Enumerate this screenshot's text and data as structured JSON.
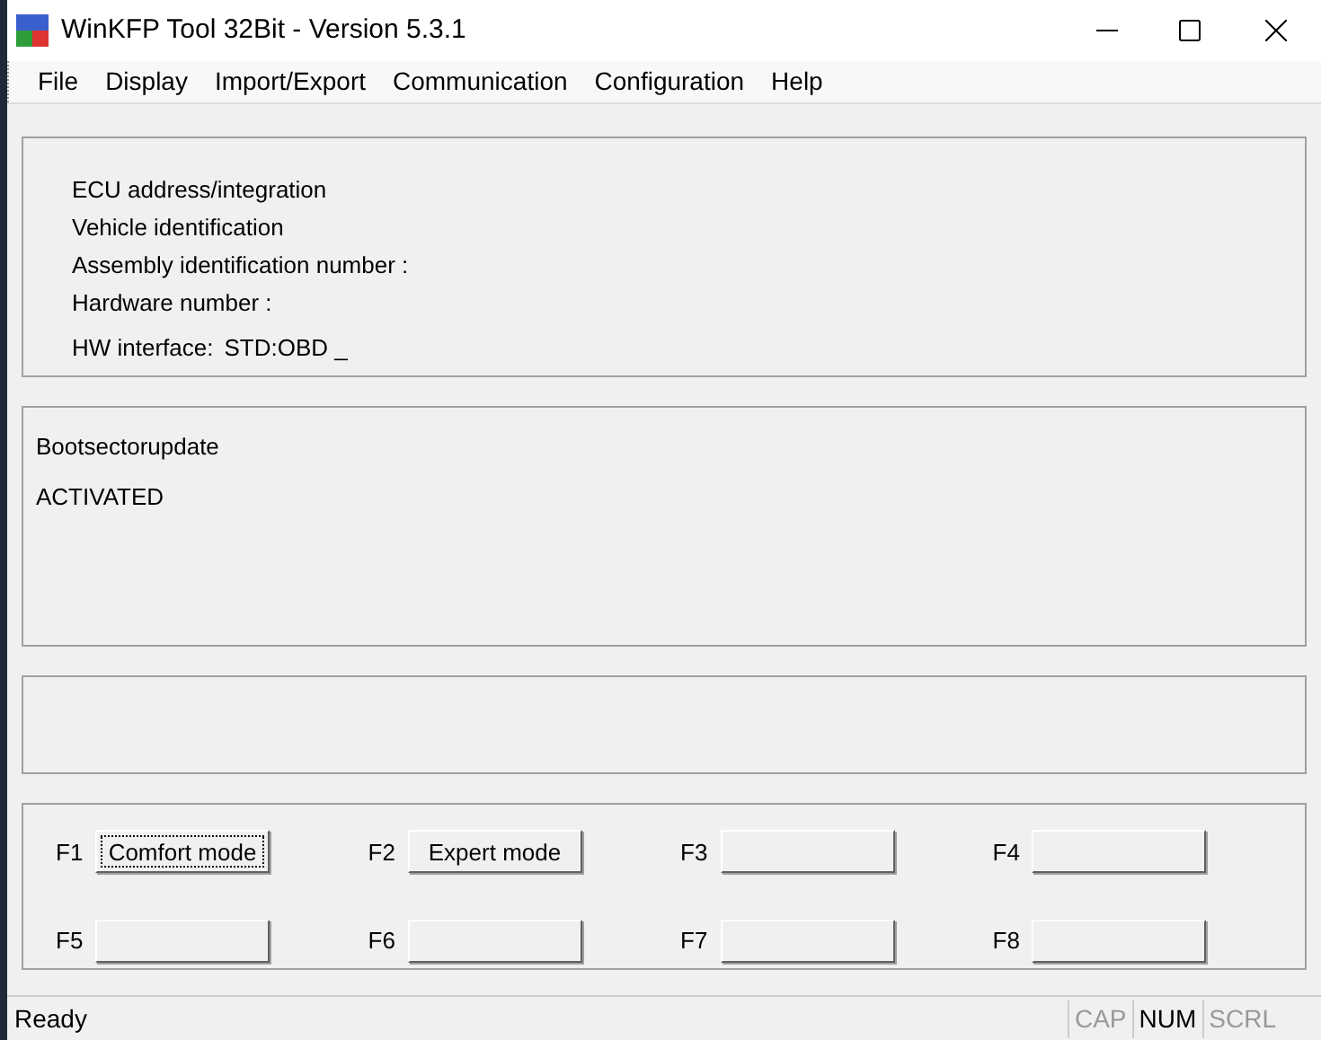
{
  "window": {
    "title": "WinKFP Tool 32Bit - Version 5.3.1"
  },
  "menu": [
    "File",
    "Display",
    "Import/Export",
    "Communication",
    "Configuration",
    "Help"
  ],
  "info_panel": {
    "lines": [
      "ECU address/integration",
      "Vehicle identification",
      "Assembly identification number :",
      "Hardware number :"
    ],
    "hw_interface": {
      "label": "HW interface:",
      "value": "STD:OBD _"
    }
  },
  "message_panel": {
    "lines": [
      "Bootsectorupdate",
      "ACTIVATED"
    ]
  },
  "function_keys": [
    {
      "key": "F1",
      "label": "Comfort mode",
      "focused": true
    },
    {
      "key": "F2",
      "label": "Expert mode",
      "focused": false
    },
    {
      "key": "F3",
      "focused": false
    },
    {
      "key": "F4",
      "focused": false
    },
    {
      "key": "F5",
      "focused": false
    },
    {
      "key": "F6",
      "focused": false
    },
    {
      "key": "F7",
      "focused": false
    },
    {
      "key": "F8",
      "focused": false
    }
  ],
  "status_bar": {
    "text": "Ready",
    "indicators": [
      {
        "label": "CAP",
        "on": false
      },
      {
        "label": "NUM",
        "on": true
      },
      {
        "label": "SCRL",
        "on": false
      }
    ]
  }
}
